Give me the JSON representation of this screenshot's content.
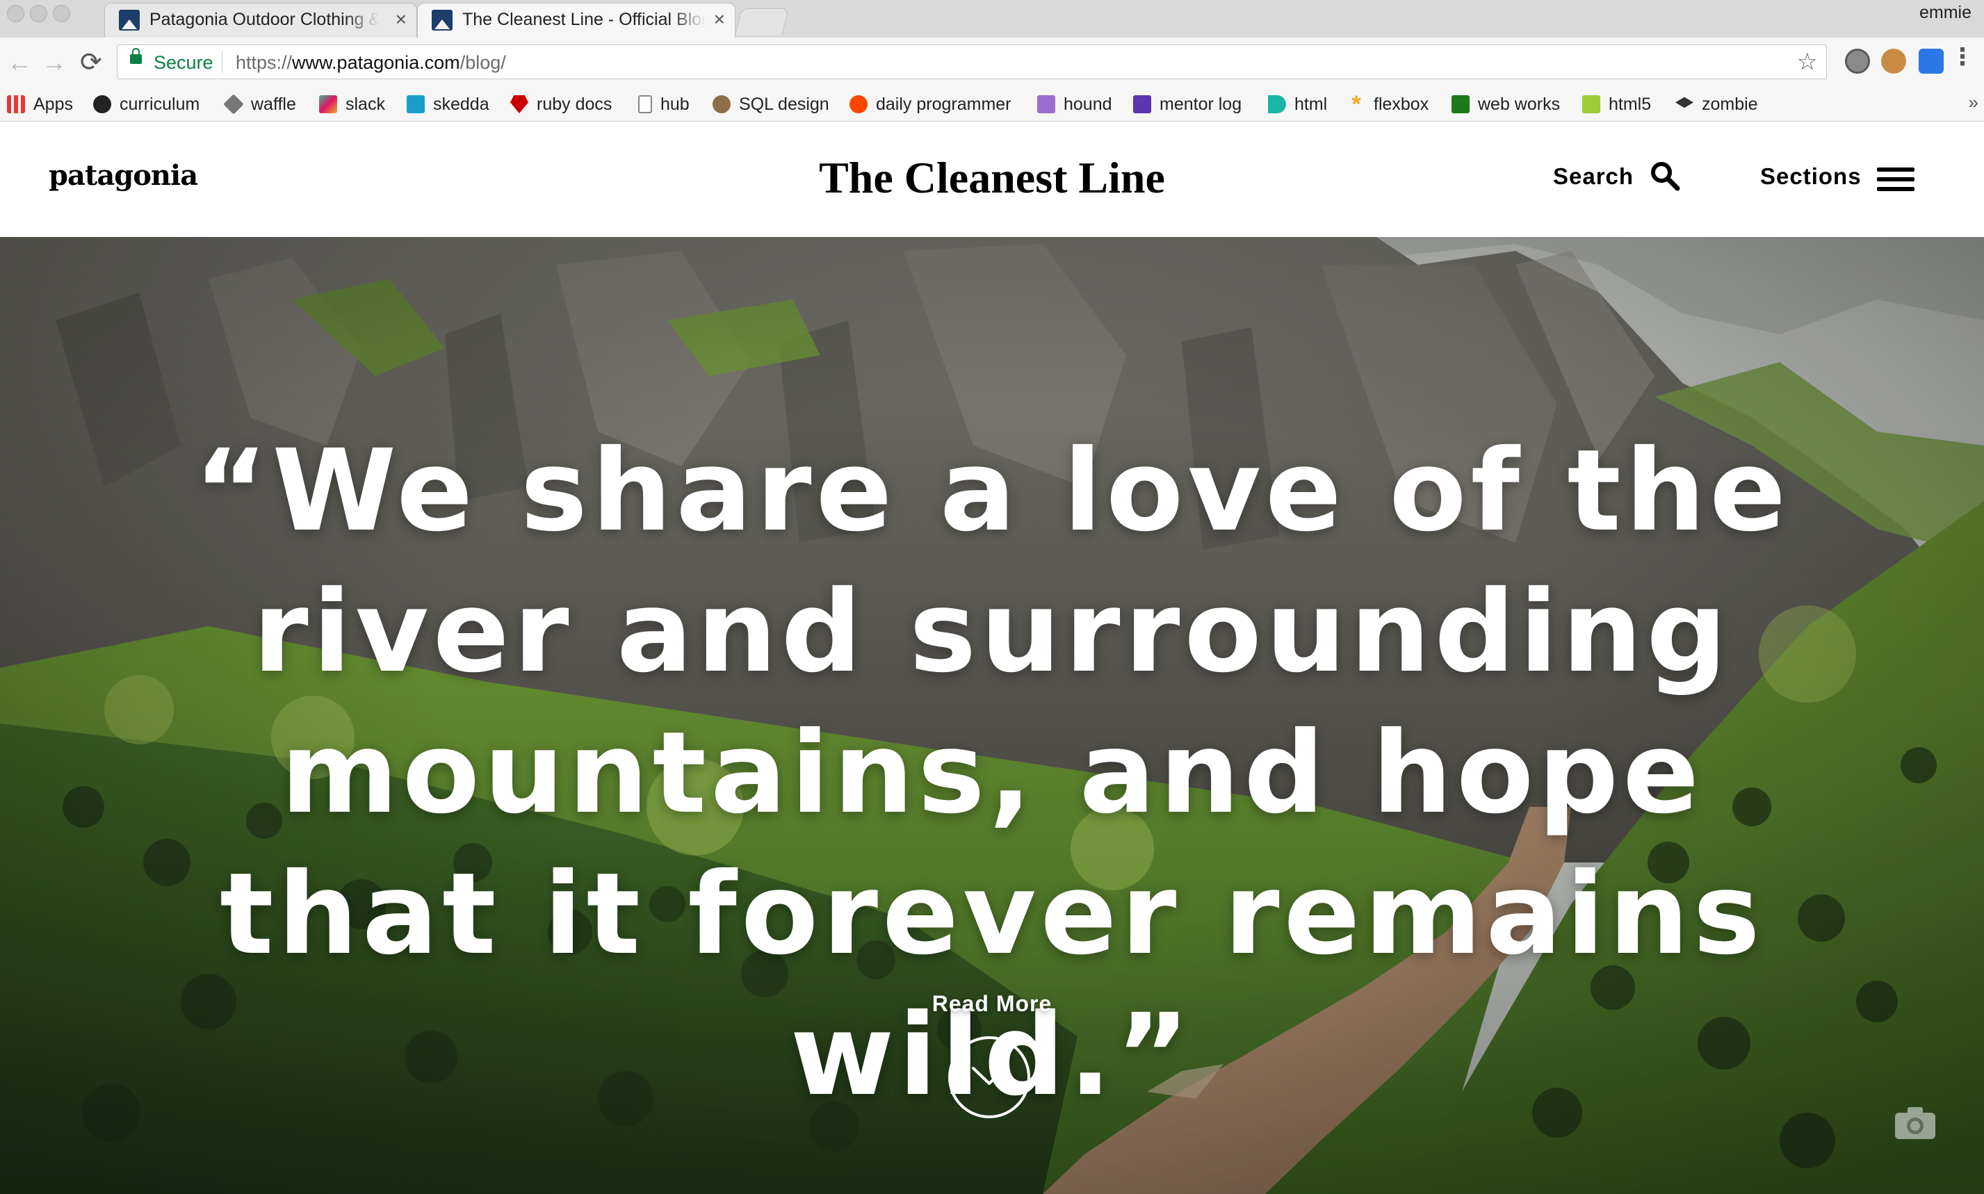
{
  "browser": {
    "tabs": [
      {
        "title": "Patagonia Outdoor Clothing & Gear",
        "close": "×"
      },
      {
        "title": "The Cleanest Line - Official Blog",
        "close": "×"
      }
    ],
    "profile": "emmie",
    "nav": {
      "back": "←",
      "forward": "→",
      "reload": "⟳"
    },
    "security_label": "Secure",
    "url_scheme": "https://",
    "url_host": "www.patagonia.com",
    "url_path": "/blog/",
    "star": "☆",
    "menu": "⋮",
    "bookmarks": [
      {
        "label": "Apps",
        "icon": "apps-grid-icon",
        "color": "#e53935"
      },
      {
        "label": "curriculum",
        "icon": "github-icon",
        "color": "#222222"
      },
      {
        "label": "waffle",
        "icon": "waffle-icon",
        "color": "#555555"
      },
      {
        "label": "slack",
        "icon": "slack-icon",
        "color": "#3eb991"
      },
      {
        "label": "skedda",
        "icon": "skedda-icon",
        "color": "#1aa0c8"
      },
      {
        "label": "ruby docs",
        "icon": "ruby-icon",
        "color": "#cc0000"
      },
      {
        "label": "hub",
        "icon": "page-icon",
        "color": "#ffffff"
      },
      {
        "label": "SQL design",
        "icon": "sql-design-icon",
        "color": "#8d6e4a"
      },
      {
        "label": "daily programmer",
        "icon": "reddit-icon",
        "color": "#ff4500"
      },
      {
        "label": "hound",
        "icon": "hound-icon",
        "color": "#9c6bd1"
      },
      {
        "label": "mentor log",
        "icon": "mentor-log-icon",
        "color": "#5e35b1"
      },
      {
        "label": "html",
        "icon": "html-d-icon",
        "color": "#19b5a5"
      },
      {
        "label": "flexbox",
        "icon": "flexbox-asterisk-icon",
        "color": "#f5a623"
      },
      {
        "label": "web works",
        "icon": "web-works-icon",
        "color": "#1b7a1b"
      },
      {
        "label": "html5",
        "icon": "html5-icon",
        "color": "#9ccc38"
      },
      {
        "label": "zombie",
        "icon": "zombie-icon",
        "color": "#333333"
      }
    ],
    "bookmarks_overflow": "»"
  },
  "site": {
    "logo": "patagonia",
    "title": "The Cleanest Line",
    "search_label": "Search",
    "sections_label": "Sections"
  },
  "hero": {
    "quote": "“We share a love of the river and surrounding mountains, and hope that it forever remains wild.”",
    "cta": "Read More",
    "colors": {
      "sky": "#c8ccc9",
      "rock": "#6c6b66",
      "grass": "#5e8c2f",
      "forest": "#2f4e1e",
      "river": "#a78566"
    }
  }
}
